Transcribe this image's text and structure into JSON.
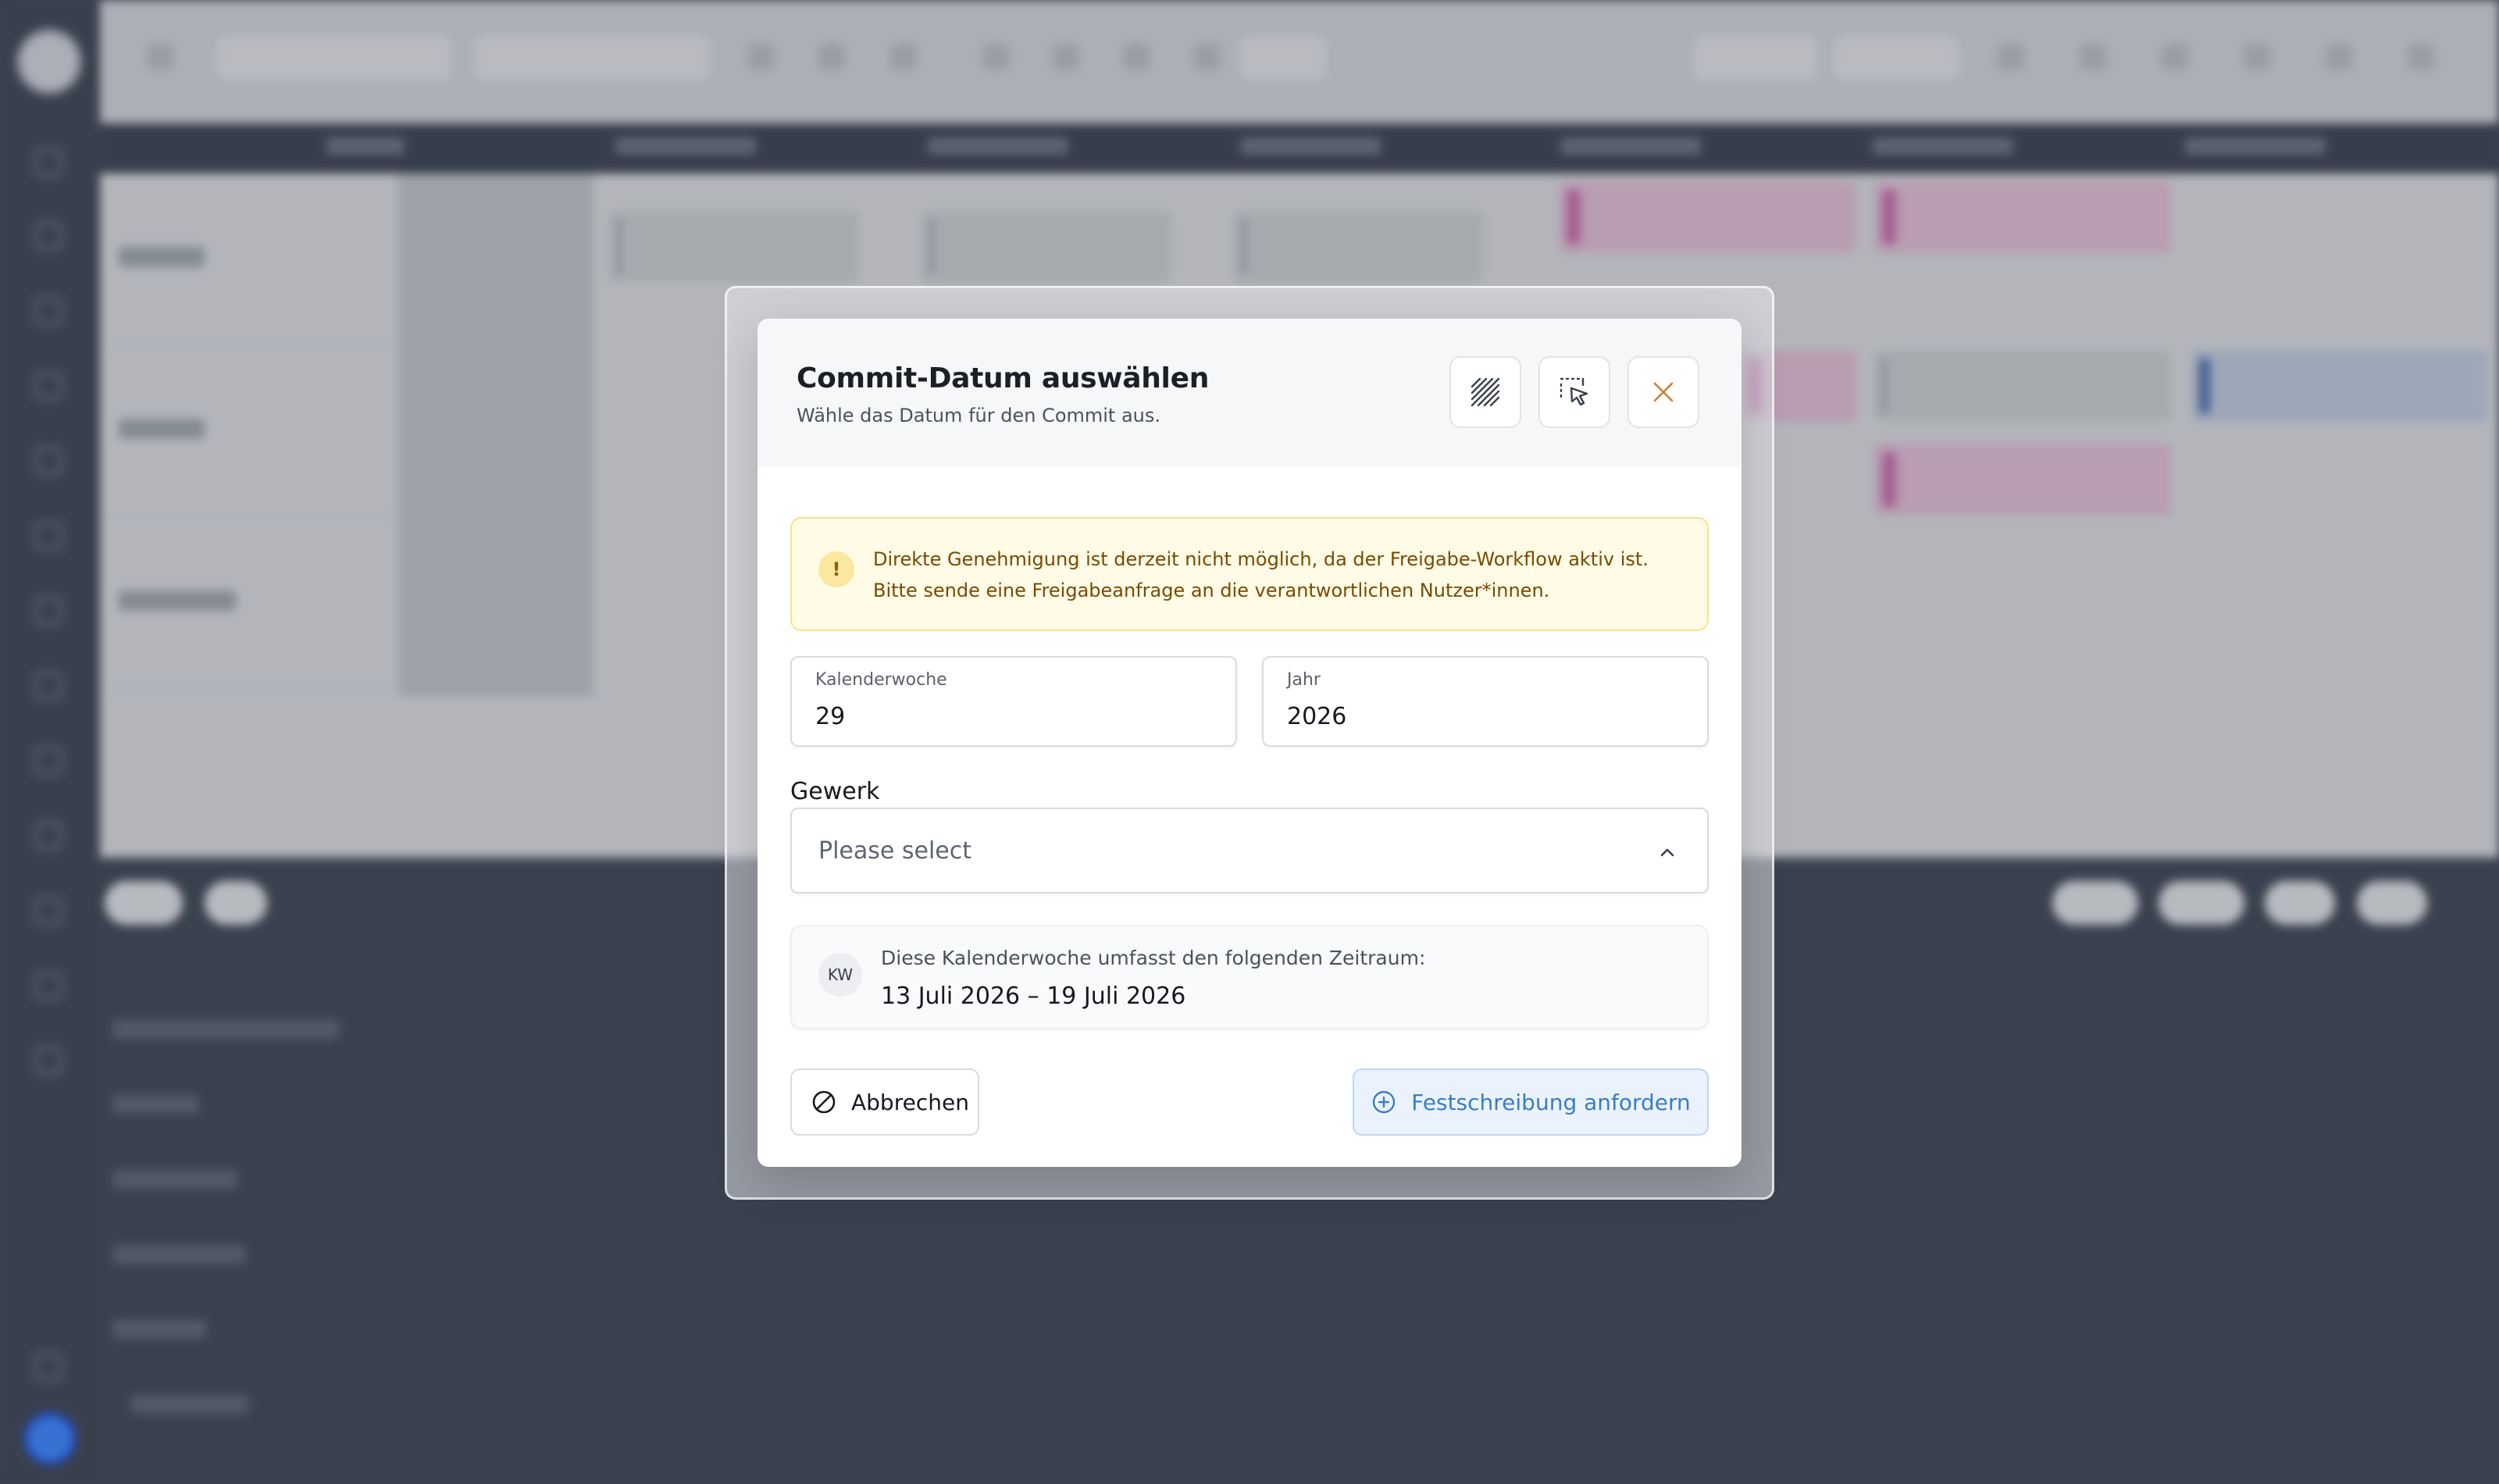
{
  "modal": {
    "title": "Commit-Datum auswählen",
    "subtitle": "Wähle das Datum für den Commit aus.",
    "alert": {
      "text": "Direkte Genehmigung ist derzeit nicht möglich, da der Freigabe-Workflow aktiv ist. Bitte sende eine Freigabeanfrage an die verantwortlichen Nutzer*innen.",
      "icon": "!"
    },
    "fields": {
      "week_label": "Kalenderwoche",
      "week_value": "29",
      "year_label": "Jahr",
      "year_value": "2026"
    },
    "gewerk": {
      "label": "Gewerk",
      "placeholder": "Please select"
    },
    "info": {
      "badge": "KW",
      "text": "Diese Kalenderwoche umfasst den folgenden Zeitraum:",
      "range": "13 Juli 2026 – 19 Juli 2026"
    },
    "buttons": {
      "cancel": "Abbrechen",
      "submit": "Festschreibung anfordern"
    },
    "header_icons": [
      "hatch-pattern-icon",
      "select-cursor-icon",
      "close-icon"
    ]
  },
  "colors": {
    "alert_bg": "#fffbe6",
    "alert_border": "#f7e38a",
    "alert_text": "#7a4a00",
    "primary": "#3b7cc8",
    "close_icon": "#c9803a"
  }
}
